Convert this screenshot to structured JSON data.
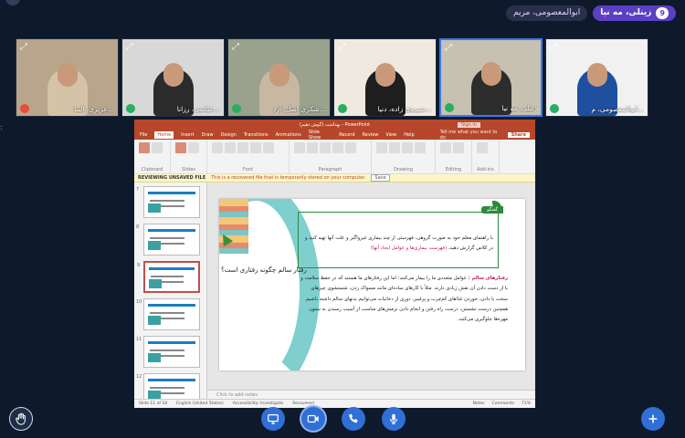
{
  "header": {
    "participant_chip": "ابوالمعصومی، مریم",
    "my_chip_label": "زینلی، مه نیا",
    "my_chip_count": "9"
  },
  "tiles": [
    {
      "name": "عزیزی، الینا...",
      "mic": "off",
      "scene_color": "#b8a58c",
      "shirt_color": "#d4c3a6",
      "active": false
    },
    {
      "name": "عباسی، رزانا...",
      "mic": "on",
      "scene_color": "#d8d8d8",
      "shirt_color": "#2b2b2b",
      "active": false
    },
    {
      "name": "شکری اصل، آرد...",
      "mic": "on",
      "scene_color": "#9aa18c",
      "shirt_color": "#c7b7a3",
      "active": false
    },
    {
      "name": "صبروی زاده، دنیا...",
      "mic": "on",
      "scene_color": "#efe9df",
      "shirt_color": "#1e1e1e",
      "active": false
    },
    {
      "name": "زینلی، مه نیا",
      "mic": "on",
      "scene_color": "#c7c1b2",
      "shirt_color": "#2d2d2d",
      "active": true
    },
    {
      "name": "ابوالمعصومی، م...",
      "mic": "on",
      "scene_color": "#f1f1f1",
      "shirt_color": "#1f4f9f",
      "active": false
    }
  ],
  "ppt": {
    "title": "(گوش دهیم) بهداشت - PowerPoint",
    "sign_in": "Sign in",
    "tabs": [
      "File",
      "Home",
      "Insert",
      "Draw",
      "Design",
      "Transitions",
      "Animations",
      "Slide Show",
      "Record",
      "Review",
      "View",
      "Help"
    ],
    "tell_me": "Tell me what you want to do",
    "share": "Share",
    "ribbon_groups": [
      "Clipboard",
      "Slides",
      "Font",
      "Paragraph",
      "Drawing",
      "Editing",
      "Add-ins"
    ],
    "protected_label": "REVIEWING UNSAVED FILE",
    "protected_msg": "This is a recovered file that is temporarily stored on your computer.",
    "protected_btn": "Save",
    "thumb_numbers": [
      "7",
      "8",
      "9",
      "10",
      "11",
      "12",
      "13"
    ],
    "slide": {
      "tag": "گفتگو",
      "box_line1": "با راهنمای معلم خود به صورت گروهی، فهرستی از چند بیماری غیرواگیر و علت آنها تهیه کنید و",
      "box_line2_a": "در کلاس گزارش دهید.",
      "box_line2_hl": "(فهرست بیماری‌ها و عوامل ایجاد آنها)",
      "para_hl": "رفتارهای سالم :",
      "para_rest": "عوامل متعددی ما را بیمار می‌کنند؛ اما این رفتارهای ما هستند که در حفظ سلامت و یا از دست دادن آن نقش زیادی دارند. مثلاً با کارهای ساده‌ای مانند مسواک زدن، شستشوی چیزهای سخت یا دادن، خوردن غذاهای کم‌چرب و پرفیبر، دوری از دخانیات می‌توانیم بدنهای سالم داشته باشیم. همچنین درست نشستن، درست راه رفتن و انجام دادن نرمش‌های مناسب از آسیب رسیدن به ستون مهره‌ها جلوگیری می‌کنند."
    },
    "overlay_question": "رفتار سالم چگونه رفتاری است؟",
    "notes_placeholder": "Click to add notes",
    "status_left": [
      "Slide 11 of 18",
      "English (United States)",
      "Accessibility: Investigate",
      "Recovered"
    ],
    "status_right": [
      "Notes",
      "Comments",
      "71%"
    ]
  },
  "toolbar": {
    "buttons": [
      "raise-hand",
      "share-screen",
      "camera",
      "phone",
      "microphone",
      "add"
    ]
  }
}
